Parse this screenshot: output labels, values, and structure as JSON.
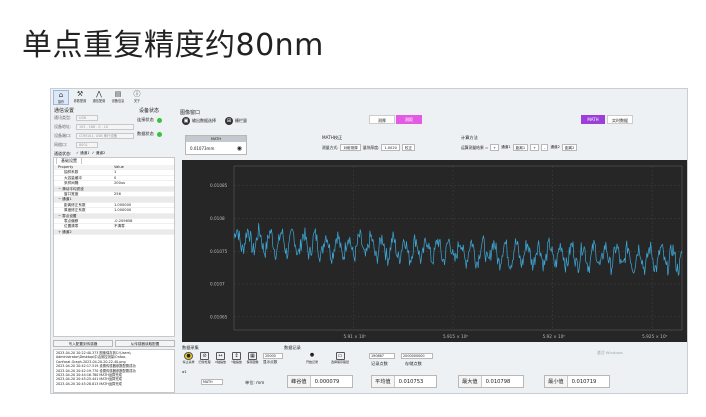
{
  "slide": {
    "title": "单点重复精度约80nm"
  },
  "toolbar": {
    "items": [
      {
        "label": "操作",
        "icon": "home-icon"
      },
      {
        "label": "参数配置",
        "icon": "tools-icon"
      },
      {
        "label": "通信配置",
        "icon": "signal-icon"
      },
      {
        "label": "设备信息",
        "icon": "device-icon"
      },
      {
        "label": "关于",
        "icon": "info-icon"
      }
    ]
  },
  "connection": {
    "title": "通信设置",
    "rows": [
      {
        "label": "通讯类型:",
        "value": "USB"
      },
      {
        "label": "设备地址:",
        "value": "192 . 168 . 0 . 10"
      },
      {
        "label": "设备端口:",
        "value": "COM101, USB 串行设备"
      },
      {
        "label": "网络口:",
        "value": "8001"
      }
    ],
    "channel_label": "通道状态:",
    "channel_values": [
      "✓ 通道1",
      "✓ 通道2"
    ]
  },
  "device_status": {
    "title": "设备状态",
    "items": [
      "连接状态",
      "数据状态"
    ]
  },
  "properties": {
    "tab": "基础设置",
    "header": {
      "k": "Property",
      "v": "Value"
    },
    "rows": [
      {
        "k": "抽样系数",
        "v": "1",
        "type": "row"
      },
      {
        "k": "大容量缓冲",
        "v": "0",
        "type": "row"
      },
      {
        "k": "采样间隔",
        "v": "200us",
        "type": "row"
      },
      {
        "k": "− 滑动平均滤波",
        "v": "",
        "type": "cat"
      },
      {
        "k": "窗口宽度",
        "v": "256",
        "type": "row"
      },
      {
        "k": "− 通道1",
        "v": "",
        "type": "cat"
      },
      {
        "k": "距离修正系数",
        "v": "1.000000",
        "type": "row"
      },
      {
        "k": "厚度修正系数",
        "v": "1.000000",
        "type": "row"
      },
      {
        "k": "− 零点设置",
        "v": "",
        "type": "cat"
      },
      {
        "k": "零点偏移",
        "v": "-0.209658",
        "type": "row"
      },
      {
        "k": "位置清零",
        "v": "不清零",
        "type": "row"
      },
      {
        "k": "+ 通道2",
        "v": "",
        "type": "cat"
      }
    ]
  },
  "buttons": {
    "write": "写入配置到传感器",
    "read": "从传感器读取配置"
  },
  "log": {
    "lines": [
      "2023-04-20 20:22:40.373 图像保存到C:\\Users\\",
      "Administrator\\Desktop\\中冶测控测量\\Ontoo-",
      "Confocal-Graph-2023-04-20-20-22-40.png",
      "2023-04-20 20:42:17.519 设置传感器参数配置成功",
      "2023-04-20 20:42:19.770 设置传感器参数配置成功",
      "2023-04-20 20:44:16.780 MATH运算完成",
      "2023-04-20 20:45:25.441 MATH运算完成",
      "2023-04-20 20:45:28.813 MATH运算完成"
    ]
  },
  "graph": {
    "title": "图像窗口",
    "export_btn": "输出数据选择",
    "grid_btn": "栅栏量",
    "tab_measure": "测厚",
    "tab_distance": "测距",
    "math_tab": "MATH",
    "realtime_tab": "实时数据",
    "math_box": {
      "header": "MATH",
      "value": "0.01073mm"
    },
    "math_calc_label": "MATH校正",
    "calc_method_label": "计算方法",
    "method_label": "测量方式:",
    "method_value": "对射测厚",
    "ref_label": "量块厚度:",
    "ref_value": "1.0020",
    "calib_btn": "校正",
    "calc_result_label": "运算测量结果 =",
    "calc_parts": [
      "+",
      "通道1",
      "距离1",
      "+",
      "-",
      "通道2",
      "距离2"
    ]
  },
  "capture": {
    "title": "数据采集",
    "record_title": "数据记录",
    "buttons": [
      "停止采样",
      "归零处理",
      "X轴缩放",
      "Y轴缩放",
      "保存图像"
    ],
    "points_label": "显示点数",
    "points_value": "20000",
    "start_record": "开始记录",
    "select_path": "选择保存路径",
    "record_points_value": "190867",
    "record_points_label": "记录点数",
    "storage_value": "2000000000",
    "storage_label": "存储点数",
    "sigma_label": "σ1",
    "channel_select": "MATH",
    "unit_label": "单位: mm"
  },
  "stats": [
    {
      "k": "峰谷值",
      "v": "0.000079"
    },
    {
      "k": "平均值",
      "v": "0.010753"
    },
    {
      "k": "最大值",
      "v": "0.010798"
    },
    {
      "k": "最小值",
      "v": "0.010719"
    }
  ],
  "watermark": "激活 Windows",
  "chart_data": {
    "type": "line",
    "title": "",
    "xlabel": "",
    "ylabel": "",
    "x_ticks": [
      "5.91 × 10⁶",
      "5.915 × 10⁶",
      "5.92 × 10⁶",
      "5.925 × 10⁶"
    ],
    "x_tick_values": [
      5910000,
      5915000,
      5920000,
      5925000
    ],
    "xlim": [
      5904000,
      5926500
    ],
    "y_ticks": [
      "0.01085",
      "0.0108",
      "0.01075",
      "0.0107",
      "0.01065"
    ],
    "y_tick_values": [
      0.01085,
      0.0108,
      0.01075,
      0.0107,
      0.01065
    ],
    "ylim": [
      0.01063,
      0.01088
    ],
    "series": [
      {
        "name": "",
        "color": "#3ea8d8",
        "trend_start": 0.01077,
        "trend_end": 0.010738,
        "amplitude": 2.8e-05,
        "x_start": 5904000,
        "x_end": 5926500
      }
    ],
    "background": "#262626",
    "grid": true
  },
  "colors": {
    "accent_pink": "#e35be3",
    "accent_purple": "#9b3fd8",
    "status_green": "#36c33f",
    "line_blue": "#3ea8d8"
  }
}
